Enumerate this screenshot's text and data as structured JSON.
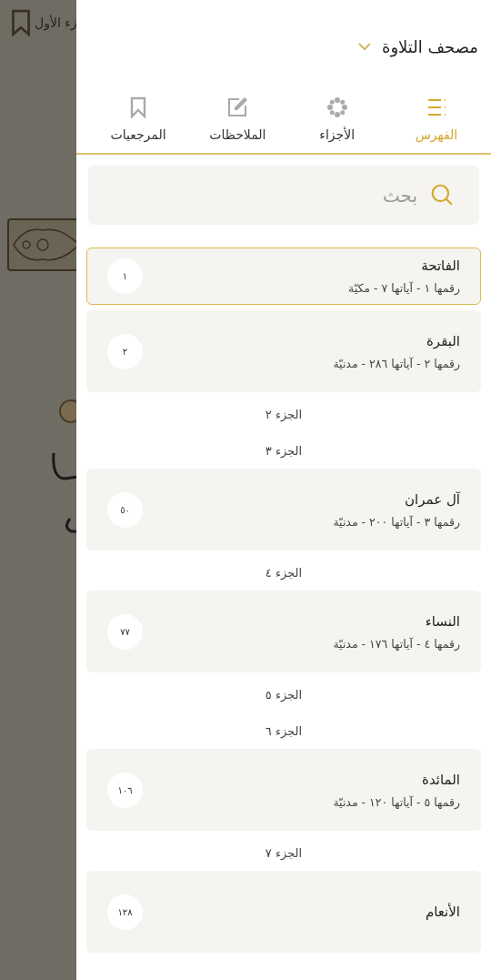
{
  "background": {
    "header_text": "زء الأول"
  },
  "drawer": {
    "title": "مصحف التلاوة",
    "tabs": [
      {
        "label": "الفهرس",
        "selected": true
      },
      {
        "label": "الأجزاء",
        "selected": false
      },
      {
        "label": "الملاحظات",
        "selected": false
      },
      {
        "label": "المرجعيات",
        "selected": false
      }
    ],
    "search": {
      "placeholder": "بحث"
    },
    "items": [
      {
        "kind": "surah",
        "name": "الفاتحة",
        "details": "رقمها ١ - آياتها ٧ - مكيّة",
        "page": "١",
        "selected": true
      },
      {
        "kind": "surah",
        "name": "البقرة",
        "details": "رقمها ٢ - آياتها ٢٨٦ - مدنيّة",
        "page": "٢",
        "selected": false
      },
      {
        "kind": "juz",
        "label": "الجزء ٢"
      },
      {
        "kind": "juz",
        "label": "الجزء ٣"
      },
      {
        "kind": "surah",
        "name": "آل عمران",
        "details": "رقمها ٣ - آياتها ٢٠٠ - مدنيّة",
        "page": "٥٠",
        "selected": false
      },
      {
        "kind": "juz",
        "label": "الجزء ٤"
      },
      {
        "kind": "surah",
        "name": "النساء",
        "details": "رقمها ٤ - آياتها ١٧٦ - مدنيّة",
        "page": "٧٧",
        "selected": false
      },
      {
        "kind": "juz",
        "label": "الجزء ٥"
      },
      {
        "kind": "juz",
        "label": "الجزء ٦"
      },
      {
        "kind": "surah",
        "name": "المائدة",
        "details": "رقمها ٥ - آياتها ١٢٠ - مدنيّة",
        "page": "١٠٦",
        "selected": false
      },
      {
        "kind": "juz",
        "label": "الجزء ٧"
      },
      {
        "kind": "surah",
        "name": "الأنعام",
        "page": "١٢٨",
        "selected": false
      }
    ]
  }
}
